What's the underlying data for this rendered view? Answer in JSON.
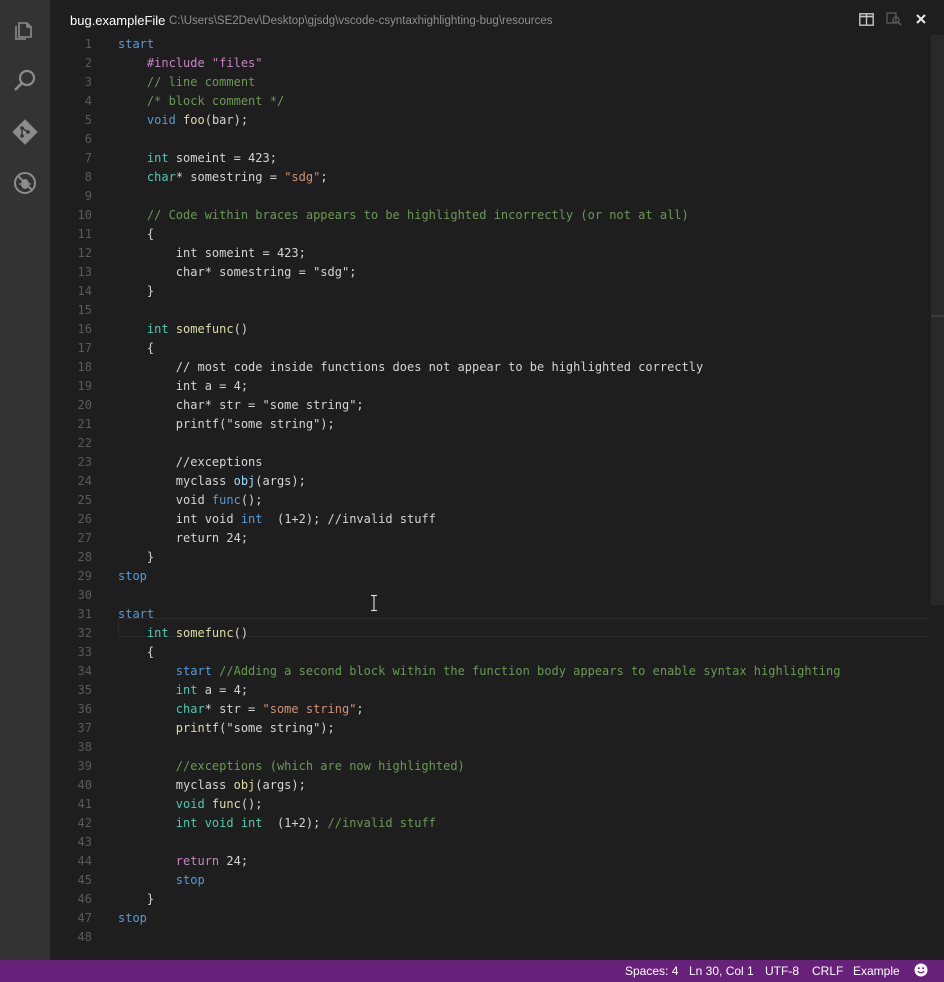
{
  "activity_bar": [
    {
      "icon": "explorer-icon"
    },
    {
      "icon": "search-icon"
    },
    {
      "icon": "git-icon"
    },
    {
      "icon": "debug-icon"
    }
  ],
  "title": {
    "filename": "bug.exampleFile",
    "path": "C:\\Users\\SE2Dev\\Desktop\\gjsdg\\vscode-csyntaxhighlighting-bug\\resources"
  },
  "title_actions": [
    "split-editor-icon",
    "open-changes-icon",
    "close-icon"
  ],
  "lines": [
    {
      "num": "1",
      "tokens": [
        [
          "start",
          "k"
        ]
      ]
    },
    {
      "num": "2",
      "tokens": [
        [
          "    ",
          ""
        ],
        [
          "#include \"files\"",
          "r"
        ]
      ]
    },
    {
      "num": "3",
      "tokens": [
        [
          "    ",
          ""
        ],
        [
          "// line comment",
          "c"
        ]
      ]
    },
    {
      "num": "4",
      "tokens": [
        [
          "    ",
          ""
        ],
        [
          "/* block comment */",
          "c"
        ]
      ]
    },
    {
      "num": "5",
      "tokens": [
        [
          "    ",
          ""
        ],
        [
          "void ",
          "k"
        ],
        [
          "foo",
          "f"
        ],
        [
          "(bar);",
          ""
        ]
      ]
    },
    {
      "num": "6",
      "tokens": []
    },
    {
      "num": "7",
      "tokens": [
        [
          "    ",
          ""
        ],
        [
          "int ",
          "t"
        ],
        [
          "someint = 423;",
          ""
        ]
      ]
    },
    {
      "num": "8",
      "tokens": [
        [
          "    ",
          ""
        ],
        [
          "char",
          "t"
        ],
        [
          "* somestring = ",
          ""
        ],
        [
          "\"sdg\"",
          "s"
        ],
        [
          ";",
          ""
        ]
      ]
    },
    {
      "num": "9",
      "tokens": []
    },
    {
      "num": "10",
      "tokens": [
        [
          "    ",
          ""
        ],
        [
          "// Code within braces appears to be highlighted incorrectly (or not at all)",
          "c"
        ]
      ]
    },
    {
      "num": "11",
      "tokens": [
        [
          "    {",
          ""
        ]
      ]
    },
    {
      "num": "12",
      "tokens": [
        [
          "        int someint = 423;",
          ""
        ]
      ]
    },
    {
      "num": "13",
      "tokens": [
        [
          "        char* somestring = \"sdg\";",
          ""
        ]
      ]
    },
    {
      "num": "14",
      "tokens": [
        [
          "    }",
          ""
        ]
      ]
    },
    {
      "num": "15",
      "tokens": []
    },
    {
      "num": "16",
      "tokens": [
        [
          "    ",
          ""
        ],
        [
          "int ",
          "t"
        ],
        [
          "somefunc",
          "f"
        ],
        [
          "()",
          ""
        ]
      ]
    },
    {
      "num": "17",
      "tokens": [
        [
          "    {",
          ""
        ]
      ]
    },
    {
      "num": "18",
      "tokens": [
        [
          "        // most code inside functions does not appear to be highlighted correctly",
          ""
        ]
      ]
    },
    {
      "num": "19",
      "tokens": [
        [
          "        int a = 4;",
          ""
        ]
      ]
    },
    {
      "num": "20",
      "tokens": [
        [
          "        char* str = \"some string\";",
          ""
        ]
      ]
    },
    {
      "num": "21",
      "tokens": [
        [
          "        printf(\"some string\");",
          ""
        ]
      ]
    },
    {
      "num": "22",
      "tokens": []
    },
    {
      "num": "23",
      "tokens": [
        [
          "        //exceptions",
          ""
        ]
      ]
    },
    {
      "num": "24",
      "tokens": [
        [
          "        myclass ",
          ""
        ],
        [
          "obj",
          "p"
        ],
        [
          "(args);",
          ""
        ]
      ]
    },
    {
      "num": "25",
      "tokens": [
        [
          "        void ",
          ""
        ],
        [
          "func",
          "k"
        ],
        [
          "();",
          ""
        ]
      ]
    },
    {
      "num": "26",
      "tokens": [
        [
          "        int void ",
          ""
        ],
        [
          "int",
          "k"
        ],
        [
          "  (1+2); //invalid stuff",
          ""
        ]
      ]
    },
    {
      "num": "27",
      "tokens": [
        [
          "        return 24;",
          ""
        ]
      ]
    },
    {
      "num": "28",
      "tokens": [
        [
          "    }",
          ""
        ]
      ]
    },
    {
      "num": "29",
      "tokens": [
        [
          "stop",
          "k"
        ]
      ]
    },
    {
      "num": "30",
      "tokens": []
    },
    {
      "num": "31",
      "tokens": [
        [
          "start",
          "k"
        ]
      ]
    },
    {
      "num": "32",
      "tokens": [
        [
          "    ",
          ""
        ],
        [
          "int ",
          "t"
        ],
        [
          "somefunc",
          "f"
        ],
        [
          "()",
          ""
        ]
      ]
    },
    {
      "num": "33",
      "tokens": [
        [
          "    {",
          ""
        ]
      ]
    },
    {
      "num": "34",
      "tokens": [
        [
          "        ",
          ""
        ],
        [
          "start ",
          "k"
        ],
        [
          "//Adding a second block within the function body appears to enable syntax highlighting",
          "c"
        ]
      ]
    },
    {
      "num": "35",
      "tokens": [
        [
          "        ",
          ""
        ],
        [
          "int ",
          "t"
        ],
        [
          "a = 4;",
          ""
        ]
      ]
    },
    {
      "num": "36",
      "tokens": [
        [
          "        ",
          ""
        ],
        [
          "char",
          "t"
        ],
        [
          "* str = ",
          ""
        ],
        [
          "\"some string\"",
          "s"
        ],
        [
          ";",
          ""
        ]
      ]
    },
    {
      "num": "37",
      "tokens": [
        [
          "        ",
          ""
        ],
        [
          "printf",
          "f"
        ],
        [
          "(\"some string\");",
          ""
        ]
      ]
    },
    {
      "num": "38",
      "tokens": []
    },
    {
      "num": "39",
      "tokens": [
        [
          "        ",
          ""
        ],
        [
          "//exceptions (which are now highlighted)",
          "c"
        ]
      ]
    },
    {
      "num": "40",
      "tokens": [
        [
          "        myclass ",
          ""
        ],
        [
          "obj",
          "f"
        ],
        [
          "(args);",
          ""
        ]
      ]
    },
    {
      "num": "41",
      "tokens": [
        [
          "        ",
          ""
        ],
        [
          "void ",
          "t"
        ],
        [
          "func",
          "f"
        ],
        [
          "();",
          ""
        ]
      ]
    },
    {
      "num": "42",
      "tokens": [
        [
          "        ",
          ""
        ],
        [
          "int void int",
          "t"
        ],
        [
          "  (1+2); ",
          ""
        ],
        [
          "//invalid stuff",
          "c"
        ]
      ]
    },
    {
      "num": "43",
      "tokens": []
    },
    {
      "num": "44",
      "tokens": [
        [
          "        ",
          ""
        ],
        [
          "return ",
          "r"
        ],
        [
          "24;",
          ""
        ]
      ]
    },
    {
      "num": "45",
      "tokens": [
        [
          "        ",
          ""
        ],
        [
          "stop",
          "k"
        ]
      ]
    },
    {
      "num": "46",
      "tokens": [
        [
          "    }",
          ""
        ]
      ]
    },
    {
      "num": "47",
      "tokens": [
        [
          "stop",
          "k"
        ]
      ]
    },
    {
      "num": "48",
      "tokens": []
    }
  ],
  "status": {
    "spaces": "Spaces: 4",
    "position": "Ln 30, Col 1",
    "encoding": "UTF-8",
    "eol": "CRLF",
    "language": "Example",
    "feedback_icon": "smiley-icon"
  },
  "colors": {
    "activity_bar": "#333333",
    "editor_bg": "#1e1e1e",
    "statusbar_bg": "#68217a",
    "keyword": "#569cd6",
    "type": "#4ec9b0",
    "function": "#dcdcaa",
    "string": "#ce9178",
    "comment": "#6a9955",
    "preprocessor": "#c586c0"
  }
}
